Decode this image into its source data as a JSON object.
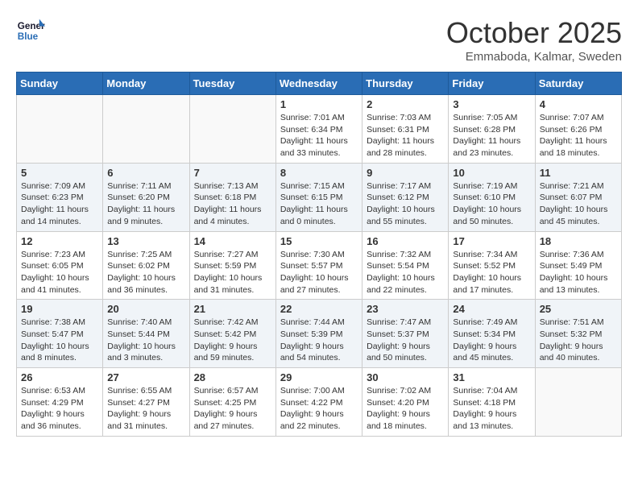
{
  "header": {
    "logo_line1": "General",
    "logo_line2": "Blue",
    "month": "October 2025",
    "location": "Emmaboda, Kalmar, Sweden"
  },
  "weekdays": [
    "Sunday",
    "Monday",
    "Tuesday",
    "Wednesday",
    "Thursday",
    "Friday",
    "Saturday"
  ],
  "weeks": [
    {
      "shaded": false,
      "days": [
        {
          "num": "",
          "info": ""
        },
        {
          "num": "",
          "info": ""
        },
        {
          "num": "",
          "info": ""
        },
        {
          "num": "1",
          "info": "Sunrise: 7:01 AM\nSunset: 6:34 PM\nDaylight: 11 hours\nand 33 minutes."
        },
        {
          "num": "2",
          "info": "Sunrise: 7:03 AM\nSunset: 6:31 PM\nDaylight: 11 hours\nand 28 minutes."
        },
        {
          "num": "3",
          "info": "Sunrise: 7:05 AM\nSunset: 6:28 PM\nDaylight: 11 hours\nand 23 minutes."
        },
        {
          "num": "4",
          "info": "Sunrise: 7:07 AM\nSunset: 6:26 PM\nDaylight: 11 hours\nand 18 minutes."
        }
      ]
    },
    {
      "shaded": true,
      "days": [
        {
          "num": "5",
          "info": "Sunrise: 7:09 AM\nSunset: 6:23 PM\nDaylight: 11 hours\nand 14 minutes."
        },
        {
          "num": "6",
          "info": "Sunrise: 7:11 AM\nSunset: 6:20 PM\nDaylight: 11 hours\nand 9 minutes."
        },
        {
          "num": "7",
          "info": "Sunrise: 7:13 AM\nSunset: 6:18 PM\nDaylight: 11 hours\nand 4 minutes."
        },
        {
          "num": "8",
          "info": "Sunrise: 7:15 AM\nSunset: 6:15 PM\nDaylight: 11 hours\nand 0 minutes."
        },
        {
          "num": "9",
          "info": "Sunrise: 7:17 AM\nSunset: 6:12 PM\nDaylight: 10 hours\nand 55 minutes."
        },
        {
          "num": "10",
          "info": "Sunrise: 7:19 AM\nSunset: 6:10 PM\nDaylight: 10 hours\nand 50 minutes."
        },
        {
          "num": "11",
          "info": "Sunrise: 7:21 AM\nSunset: 6:07 PM\nDaylight: 10 hours\nand 45 minutes."
        }
      ]
    },
    {
      "shaded": false,
      "days": [
        {
          "num": "12",
          "info": "Sunrise: 7:23 AM\nSunset: 6:05 PM\nDaylight: 10 hours\nand 41 minutes."
        },
        {
          "num": "13",
          "info": "Sunrise: 7:25 AM\nSunset: 6:02 PM\nDaylight: 10 hours\nand 36 minutes."
        },
        {
          "num": "14",
          "info": "Sunrise: 7:27 AM\nSunset: 5:59 PM\nDaylight: 10 hours\nand 31 minutes."
        },
        {
          "num": "15",
          "info": "Sunrise: 7:30 AM\nSunset: 5:57 PM\nDaylight: 10 hours\nand 27 minutes."
        },
        {
          "num": "16",
          "info": "Sunrise: 7:32 AM\nSunset: 5:54 PM\nDaylight: 10 hours\nand 22 minutes."
        },
        {
          "num": "17",
          "info": "Sunrise: 7:34 AM\nSunset: 5:52 PM\nDaylight: 10 hours\nand 17 minutes."
        },
        {
          "num": "18",
          "info": "Sunrise: 7:36 AM\nSunset: 5:49 PM\nDaylight: 10 hours\nand 13 minutes."
        }
      ]
    },
    {
      "shaded": true,
      "days": [
        {
          "num": "19",
          "info": "Sunrise: 7:38 AM\nSunset: 5:47 PM\nDaylight: 10 hours\nand 8 minutes."
        },
        {
          "num": "20",
          "info": "Sunrise: 7:40 AM\nSunset: 5:44 PM\nDaylight: 10 hours\nand 3 minutes."
        },
        {
          "num": "21",
          "info": "Sunrise: 7:42 AM\nSunset: 5:42 PM\nDaylight: 9 hours\nand 59 minutes."
        },
        {
          "num": "22",
          "info": "Sunrise: 7:44 AM\nSunset: 5:39 PM\nDaylight: 9 hours\nand 54 minutes."
        },
        {
          "num": "23",
          "info": "Sunrise: 7:47 AM\nSunset: 5:37 PM\nDaylight: 9 hours\nand 50 minutes."
        },
        {
          "num": "24",
          "info": "Sunrise: 7:49 AM\nSunset: 5:34 PM\nDaylight: 9 hours\nand 45 minutes."
        },
        {
          "num": "25",
          "info": "Sunrise: 7:51 AM\nSunset: 5:32 PM\nDaylight: 9 hours\nand 40 minutes."
        }
      ]
    },
    {
      "shaded": false,
      "days": [
        {
          "num": "26",
          "info": "Sunrise: 6:53 AM\nSunset: 4:29 PM\nDaylight: 9 hours\nand 36 minutes."
        },
        {
          "num": "27",
          "info": "Sunrise: 6:55 AM\nSunset: 4:27 PM\nDaylight: 9 hours\nand 31 minutes."
        },
        {
          "num": "28",
          "info": "Sunrise: 6:57 AM\nSunset: 4:25 PM\nDaylight: 9 hours\nand 27 minutes."
        },
        {
          "num": "29",
          "info": "Sunrise: 7:00 AM\nSunset: 4:22 PM\nDaylight: 9 hours\nand 22 minutes."
        },
        {
          "num": "30",
          "info": "Sunrise: 7:02 AM\nSunset: 4:20 PM\nDaylight: 9 hours\nand 18 minutes."
        },
        {
          "num": "31",
          "info": "Sunrise: 7:04 AM\nSunset: 4:18 PM\nDaylight: 9 hours\nand 13 minutes."
        },
        {
          "num": "",
          "info": ""
        }
      ]
    }
  ]
}
